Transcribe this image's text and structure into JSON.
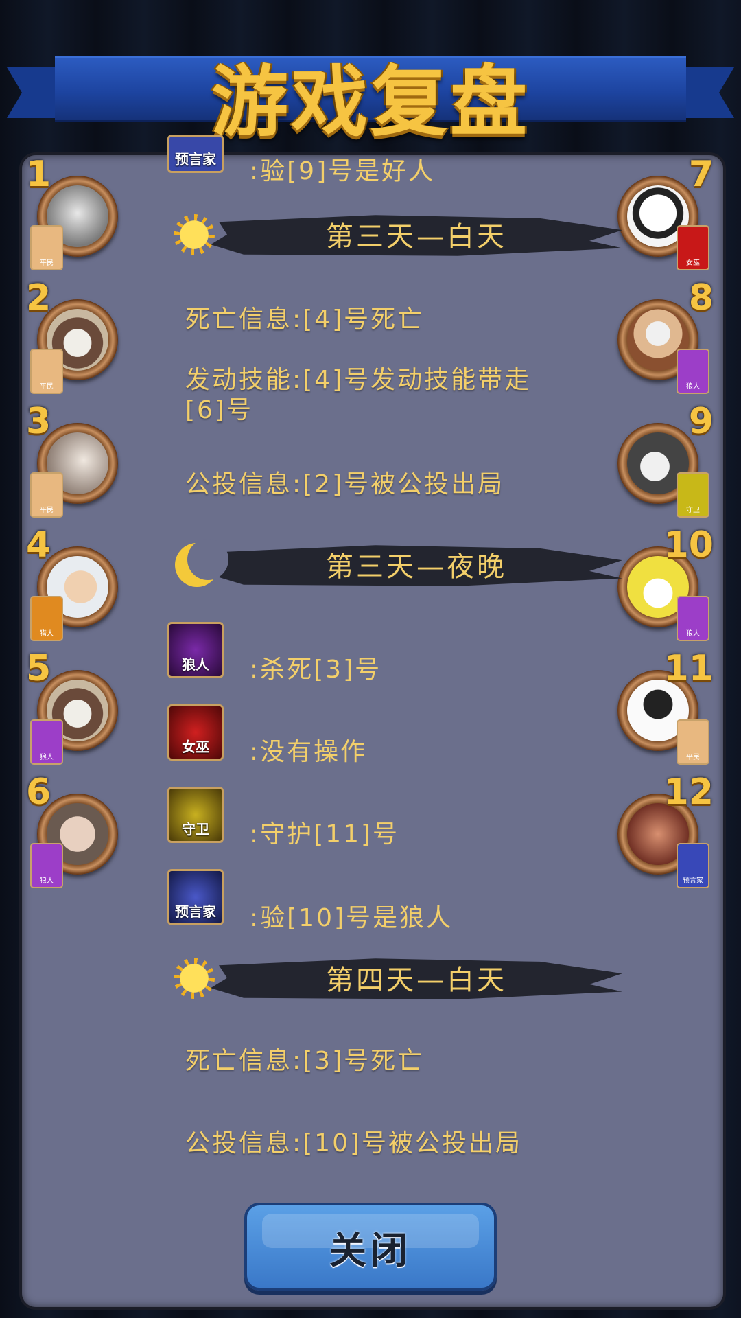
{
  "header": {
    "title": "游戏复盘"
  },
  "players_left": [
    {
      "num": "1",
      "role": "平民",
      "color": "#f0b878"
    },
    {
      "num": "2",
      "role": "平民",
      "color": "#f0b878"
    },
    {
      "num": "3",
      "role": "平民",
      "color": "#f0b878"
    },
    {
      "num": "4",
      "role": "猎人",
      "color": "#e08a20"
    },
    {
      "num": "5",
      "role": "狼人",
      "color": "#9c3ec8"
    },
    {
      "num": "6",
      "role": "狼人",
      "color": "#9c3ec8"
    }
  ],
  "players_right": [
    {
      "num": "7",
      "role": "女巫",
      "color": "#c81818"
    },
    {
      "num": "8",
      "role": "狼人",
      "color": "#9c3ec8"
    },
    {
      "num": "9",
      "role": "守卫",
      "color": "#c8b818"
    },
    {
      "num": "10",
      "role": "狼人",
      "color": "#9c3ec8"
    },
    {
      "num": "11",
      "role": "平民",
      "color": "#f0b878"
    },
    {
      "num": "12",
      "role": "预言家",
      "color": "#3848b8"
    }
  ],
  "log": {
    "top_partial": {
      "role": "预言家",
      "text": ":验[9]号是好人"
    },
    "day3_title": "第三天—白天",
    "death_info": "死亡信息:[4]号死亡",
    "skill_info": "发动技能:[4]号发动技能带走[6]号",
    "vote_info": "公投信息:[2]号被公投出局",
    "night3_title": "第三天—夜晚",
    "wolf": {
      "role": "狼人",
      "text": ":杀死[3]号"
    },
    "witch": {
      "role": "女巫",
      "text": ":没有操作"
    },
    "guard": {
      "role": "守卫",
      "text": ":守护[11]号"
    },
    "seer": {
      "role": "预言家",
      "text": ":验[10]号是狼人"
    },
    "day4_title": "第四天—白天",
    "death_info2": "死亡信息:[3]号死亡",
    "vote_info2": "公投信息:[10]号被公投出局"
  },
  "footer": {
    "close_label": "关闭"
  }
}
